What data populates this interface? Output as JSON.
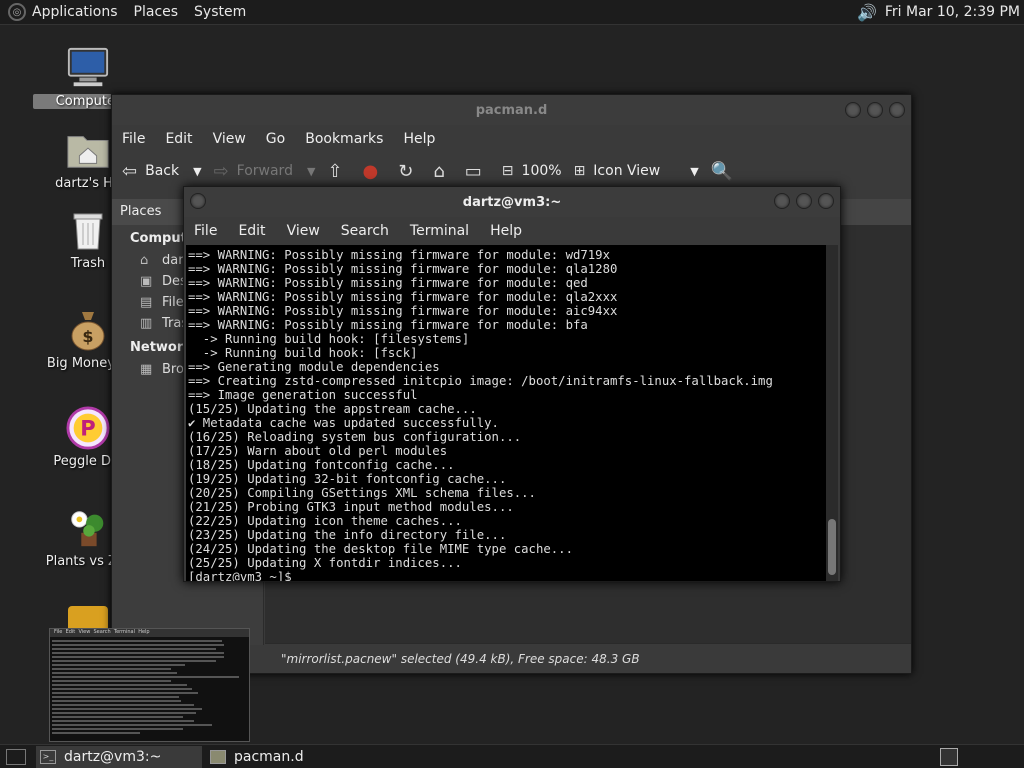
{
  "top_panel": {
    "menus": [
      "Applications",
      "Places",
      "System"
    ],
    "clock": "Fri Mar 10,  2:39 PM"
  },
  "desktop_icons": [
    {
      "label": "Computer",
      "icon": "computer-icon"
    },
    {
      "label": "dartz's Ho",
      "icon": "home-folder-icon"
    },
    {
      "label": "Trash",
      "icon": "trash-icon"
    },
    {
      "label": "Big Money D",
      "icon": "money-bag-icon"
    },
    {
      "label": "Peggle Del",
      "icon": "peggle-icon"
    },
    {
      "label": "Plants vs Zor",
      "icon": "plants-icon"
    }
  ],
  "file_manager": {
    "title": "pacman.d",
    "menus": [
      "File",
      "Edit",
      "View",
      "Go",
      "Bookmarks",
      "Help"
    ],
    "toolbar": {
      "back": "Back",
      "forward": "Forward",
      "zoom": "100%",
      "view_mode": "Icon View"
    },
    "sidebar": {
      "header": "Places",
      "sections": [
        {
          "title": "Computer",
          "items": [
            "dartz",
            "Desktop",
            "File System",
            "Trash"
          ]
        },
        {
          "title": "Network",
          "items": [
            "Browse Network"
          ]
        }
      ]
    },
    "status": "\"mirrorlist.pacnew\" selected (49.4 kB), Free space: 48.3 GB"
  },
  "terminal": {
    "title": "dartz@vm3:~",
    "menus": [
      "File",
      "Edit",
      "View",
      "Search",
      "Terminal",
      "Help"
    ],
    "lines": [
      "==> WARNING: Possibly missing firmware for module: wd719x",
      "==> WARNING: Possibly missing firmware for module: qla1280",
      "==> WARNING: Possibly missing firmware for module: qed",
      "==> WARNING: Possibly missing firmware for module: qla2xxx",
      "==> WARNING: Possibly missing firmware for module: aic94xx",
      "==> WARNING: Possibly missing firmware for module: bfa",
      "  -> Running build hook: [filesystems]",
      "  -> Running build hook: [fsck]",
      "==> Generating module dependencies",
      "==> Creating zstd-compressed initcpio image: /boot/initramfs-linux-fallback.img",
      "==> Image generation successful",
      "(15/25) Updating the appstream cache...",
      "✔ Metadata cache was updated successfully.",
      "(16/25) Reloading system bus configuration...",
      "(17/25) Warn about old perl modules",
      "(18/25) Updating fontconfig cache...",
      "(19/25) Updating 32-bit fontconfig cache...",
      "(20/25) Compiling GSettings XML schema files...",
      "(21/25) Probing GTK3 input method modules...",
      "(22/25) Updating icon theme caches...",
      "(23/25) Updating the info directory file...",
      "(24/25) Updating the desktop file MIME type cache...",
      "(25/25) Updating X fontdir indices...",
      "[dartz@vm3 ~]$ "
    ]
  },
  "thumbnail": {
    "menus": [
      "File",
      "Edit",
      "View",
      "Search",
      "Terminal",
      "Help"
    ]
  },
  "bottom_panel": {
    "tasks": [
      "dartz@vm3:~",
      "pacman.d"
    ]
  }
}
